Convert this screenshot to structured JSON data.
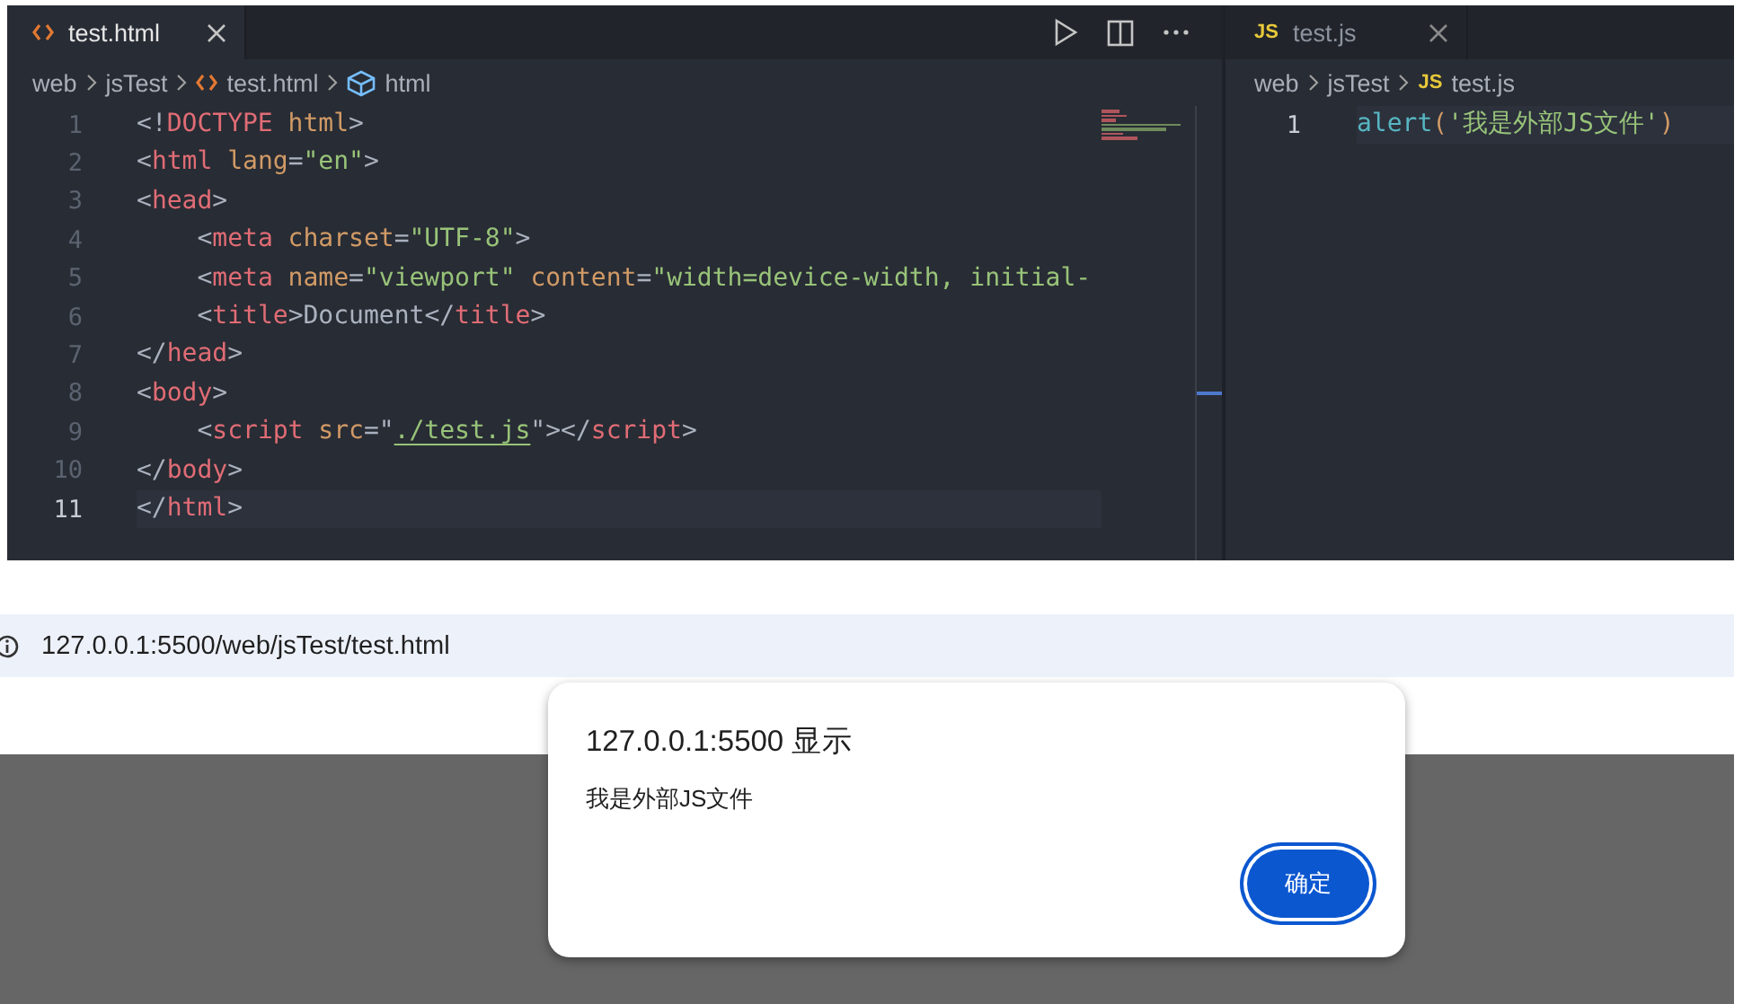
{
  "left_editor": {
    "tab": {
      "label": "test.html",
      "selected": true
    },
    "breadcrumb": [
      "web",
      "jsTest",
      "test.html",
      "html"
    ],
    "lines": [
      {
        "number": "1",
        "current": false,
        "tokens": [
          {
            "kind": "punct",
            "text": "<!"
          },
          {
            "kind": "tag",
            "text": "DOCTYPE"
          },
          {
            "kind": "attr",
            "text": " html"
          },
          {
            "kind": "punct",
            "text": ">"
          }
        ]
      },
      {
        "number": "2",
        "current": false,
        "tokens": [
          {
            "kind": "punct",
            "text": "<"
          },
          {
            "kind": "tag",
            "text": "html"
          },
          {
            "kind": "attr",
            "text": " lang"
          },
          {
            "kind": "punct",
            "text": "="
          },
          {
            "kind": "str",
            "text": "\"en\""
          },
          {
            "kind": "punct",
            "text": ">"
          }
        ]
      },
      {
        "number": "3",
        "current": false,
        "tokens": [
          {
            "kind": "punct",
            "text": "<"
          },
          {
            "kind": "tag",
            "text": "head"
          },
          {
            "kind": "punct",
            "text": ">"
          }
        ]
      },
      {
        "number": "4",
        "current": false,
        "tokens": [
          {
            "kind": "punct",
            "text": "    <"
          },
          {
            "kind": "tag",
            "text": "meta"
          },
          {
            "kind": "attr",
            "text": " charset"
          },
          {
            "kind": "punct",
            "text": "="
          },
          {
            "kind": "str",
            "text": "\"UTF-8\""
          },
          {
            "kind": "punct",
            "text": ">"
          }
        ]
      },
      {
        "number": "5",
        "current": false,
        "tokens": [
          {
            "kind": "punct",
            "text": "    <"
          },
          {
            "kind": "tag",
            "text": "meta"
          },
          {
            "kind": "attr",
            "text": " name"
          },
          {
            "kind": "punct",
            "text": "="
          },
          {
            "kind": "str",
            "text": "\"viewport\""
          },
          {
            "kind": "attr",
            "text": " content"
          },
          {
            "kind": "punct",
            "text": "="
          },
          {
            "kind": "str",
            "text": "\"width=device-width, initial-"
          }
        ]
      },
      {
        "number": "6",
        "current": false,
        "tokens": [
          {
            "kind": "punct",
            "text": "    <"
          },
          {
            "kind": "tag",
            "text": "title"
          },
          {
            "kind": "punct",
            "text": ">"
          },
          {
            "kind": "text",
            "text": "Document"
          },
          {
            "kind": "punct",
            "text": "</"
          },
          {
            "kind": "tag",
            "text": "title"
          },
          {
            "kind": "punct",
            "text": ">"
          }
        ]
      },
      {
        "number": "7",
        "current": false,
        "tokens": [
          {
            "kind": "punct",
            "text": "</"
          },
          {
            "kind": "tag",
            "text": "head"
          },
          {
            "kind": "punct",
            "text": ">"
          }
        ]
      },
      {
        "number": "8",
        "current": false,
        "tokens": [
          {
            "kind": "punct",
            "text": "<"
          },
          {
            "kind": "tag",
            "text": "body"
          },
          {
            "kind": "punct",
            "text": ">"
          }
        ]
      },
      {
        "number": "9",
        "current": false,
        "tokens": [
          {
            "kind": "punct",
            "text": "    <"
          },
          {
            "kind": "tag",
            "text": "script"
          },
          {
            "kind": "attr",
            "text": " src"
          },
          {
            "kind": "punct",
            "text": "=\""
          },
          {
            "kind": "link",
            "text": "./test.js"
          },
          {
            "kind": "punct",
            "text": "\"></"
          },
          {
            "kind": "tag",
            "text": "script"
          },
          {
            "kind": "punct",
            "text": ">"
          }
        ]
      },
      {
        "number": "10",
        "current": false,
        "tokens": [
          {
            "kind": "punct",
            "text": "</"
          },
          {
            "kind": "tag",
            "text": "body"
          },
          {
            "kind": "punct",
            "text": ">"
          }
        ]
      },
      {
        "number": "11",
        "current": true,
        "tokens": [
          {
            "kind": "punct",
            "text": "</"
          },
          {
            "kind": "tag",
            "text": "html"
          },
          {
            "kind": "punct",
            "text": ">"
          }
        ]
      }
    ]
  },
  "right_editor": {
    "tab": {
      "icon": "JS",
      "label": "test.js",
      "selected": false
    },
    "breadcrumb": [
      "web",
      "jsTest",
      "test.js"
    ],
    "breadcrumb_icon": "JS",
    "lines": [
      {
        "number": "1",
        "current": true,
        "tokens": [
          {
            "kind": "fn",
            "text": "alert"
          },
          {
            "kind": "attr",
            "text": "("
          },
          {
            "kind": "str",
            "text": "'我是外部JS文件'"
          },
          {
            "kind": "attr",
            "text": ")"
          }
        ]
      }
    ]
  },
  "browser": {
    "address": "127.0.0.1:5500/web/jsTest/test.html"
  },
  "dialog": {
    "title": "127.0.0.1:5500 显示",
    "message": "我是外部JS文件",
    "button": "确定"
  }
}
